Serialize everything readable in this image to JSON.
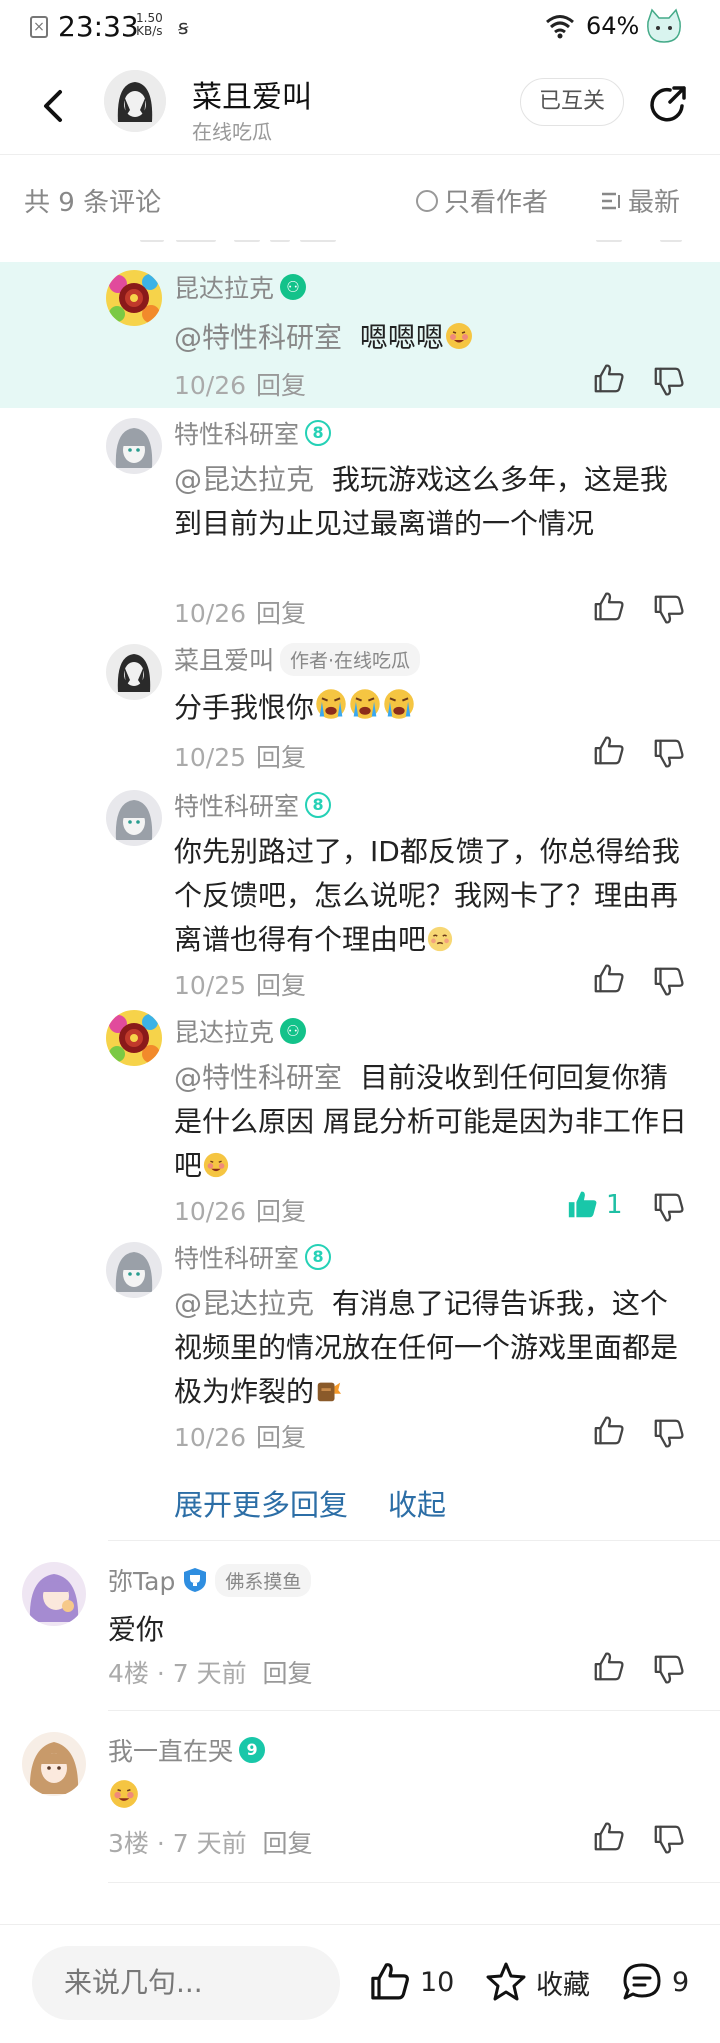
{
  "status_bar": {
    "time": "23:33",
    "net_speed_value": "1.50",
    "net_speed_unit": "KB/s",
    "battery": "64%"
  },
  "header": {
    "title": "菜且爱叫",
    "subtitle": "在线吃瓜",
    "follow_label": "已互关"
  },
  "filter": {
    "count_text": "共 9 条评论",
    "only_author": "只看作者",
    "sort": "最新"
  },
  "replies": [
    {
      "name": "昆达拉克",
      "badge": "verified",
      "mention": "@特性科研室",
      "text": "嗯嗯嗯",
      "date": "10/26",
      "reply": "回复",
      "likes": ""
    },
    {
      "name": "特性科研室",
      "badge": "8",
      "mention": "@昆达拉克",
      "text": "我玩游戏这么多年，这是我到目前为止见过最离谱的一个情况",
      "date": "10/26",
      "reply": "回复",
      "likes": ""
    },
    {
      "name": "菜且爱叫",
      "badge": "",
      "author_tag": "作者·在线吃瓜",
      "mention": "",
      "text": "分手我恨你",
      "date": "10/25",
      "reply": "回复",
      "likes": ""
    },
    {
      "name": "特性科研室",
      "badge": "8",
      "mention": "",
      "text": "你先别路过了，ID都反馈了，你总得给我个反馈吧，怎么说呢？我网卡了？理由再离谱也得有个理由吧",
      "date": "10/25",
      "reply": "回复",
      "likes": ""
    },
    {
      "name": "昆达拉克",
      "badge": "verified",
      "mention": "@特性科研室",
      "text": "目前没收到任何回复你猜是什么原因 屑昆分析可能是因为非工作日吧",
      "date": "10/26",
      "reply": "回复",
      "likes": "1"
    },
    {
      "name": "特性科研室",
      "badge": "8",
      "mention": "@昆达拉克",
      "text": "有消息了记得告诉我，这个视频里的情况放在任何一个游戏里面都是极为炸裂的",
      "date": "10/26",
      "reply": "回复",
      "likes": ""
    }
  ],
  "expand_label": "展开更多回复",
  "collapse_label": "收起",
  "comments": [
    {
      "name": "弥Tap",
      "tag": "佛系摸鱼",
      "text": "爱你",
      "floor": "4楼",
      "time": "7 天前",
      "reply": "回复"
    },
    {
      "name": "我一直在哭",
      "badge": "9",
      "text": "",
      "floor": "3楼",
      "time": "7 天前",
      "reply": "回复"
    }
  ],
  "bottom_bar": {
    "input_placeholder": "来说几句...",
    "like_count": "10",
    "favorite_label": "收藏",
    "comment_count": "9"
  },
  "colors": {
    "accent": "#19c7a9",
    "link": "#2c6ea6",
    "highlight_bg": "#e6f8f5"
  }
}
